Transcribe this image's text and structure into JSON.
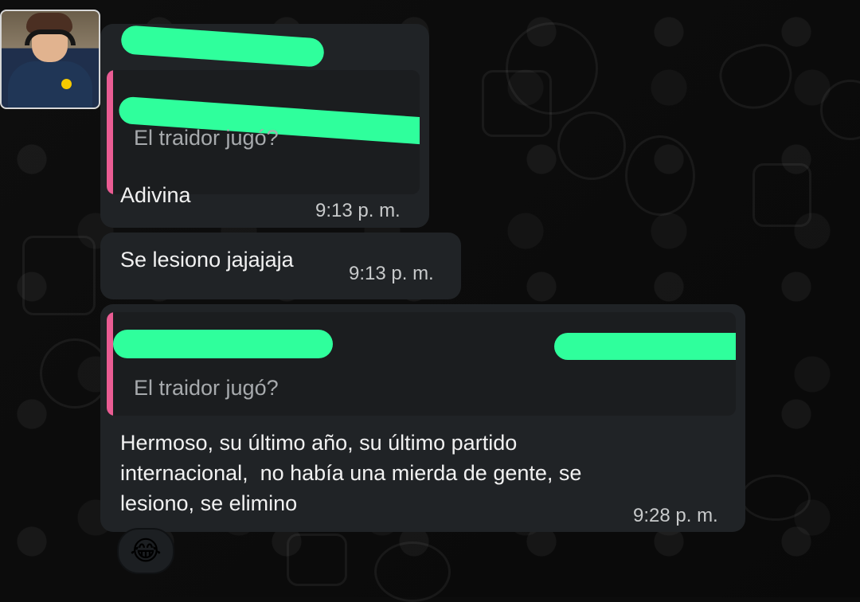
{
  "chat": {
    "messages": [
      {
        "quote": {
          "text": "El traidor jugó?"
        },
        "text": "Adivina",
        "time": "9:13 p. m."
      },
      {
        "text": "Se lesiono jajajaja",
        "time": "9:13 p. m."
      },
      {
        "quote": {
          "text": "El traidor jugó?"
        },
        "text": "Hermoso, su último año, su último partido\ninternacional,  no había una mierda de gente, se\nlesiono, se elimino",
        "time": "9:28 p. m."
      }
    ],
    "reaction": {
      "emoji": "😂"
    }
  }
}
